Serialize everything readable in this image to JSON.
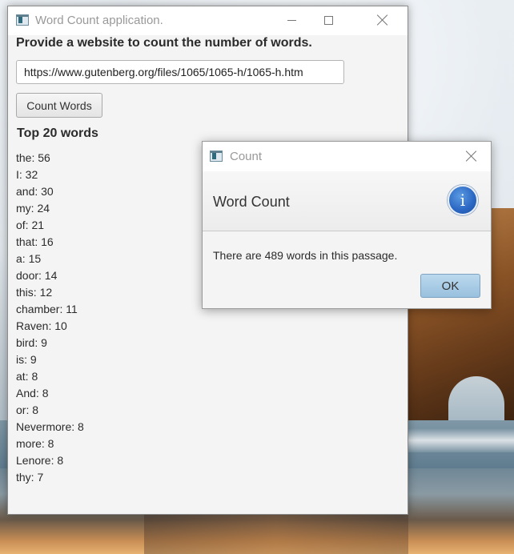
{
  "main_window": {
    "title": "Word Count application.",
    "prompt": "Provide a website to count the number of words.",
    "url_input_value": "https://www.gutenberg.org/files/1065/1065-h/1065-h.htm",
    "count_button_label": "Count Words",
    "top_heading": "Top 20 words",
    "top_words": [
      "the: 56",
      "I: 32",
      "and: 30",
      "my: 24",
      "of: 21",
      "that: 16",
      "a: 15",
      "door: 14",
      "this: 12",
      "chamber: 11",
      "Raven: 10",
      "bird: 9",
      "is: 9",
      "at: 8",
      "And: 8",
      "or: 8",
      "Nevermore: 8",
      "more: 8",
      "Lenore: 8",
      "thy: 7"
    ]
  },
  "dialog": {
    "title": "Count",
    "header_text": "Word Count",
    "message": "There are 489 words in this passage.",
    "ok_label": "OK",
    "info_icon": "info-icon",
    "info_glyph": "i"
  },
  "colors": {
    "window_bg": "#f4f4f4",
    "ok_button": "#98c0de",
    "info_icon": "#2a66c2"
  }
}
